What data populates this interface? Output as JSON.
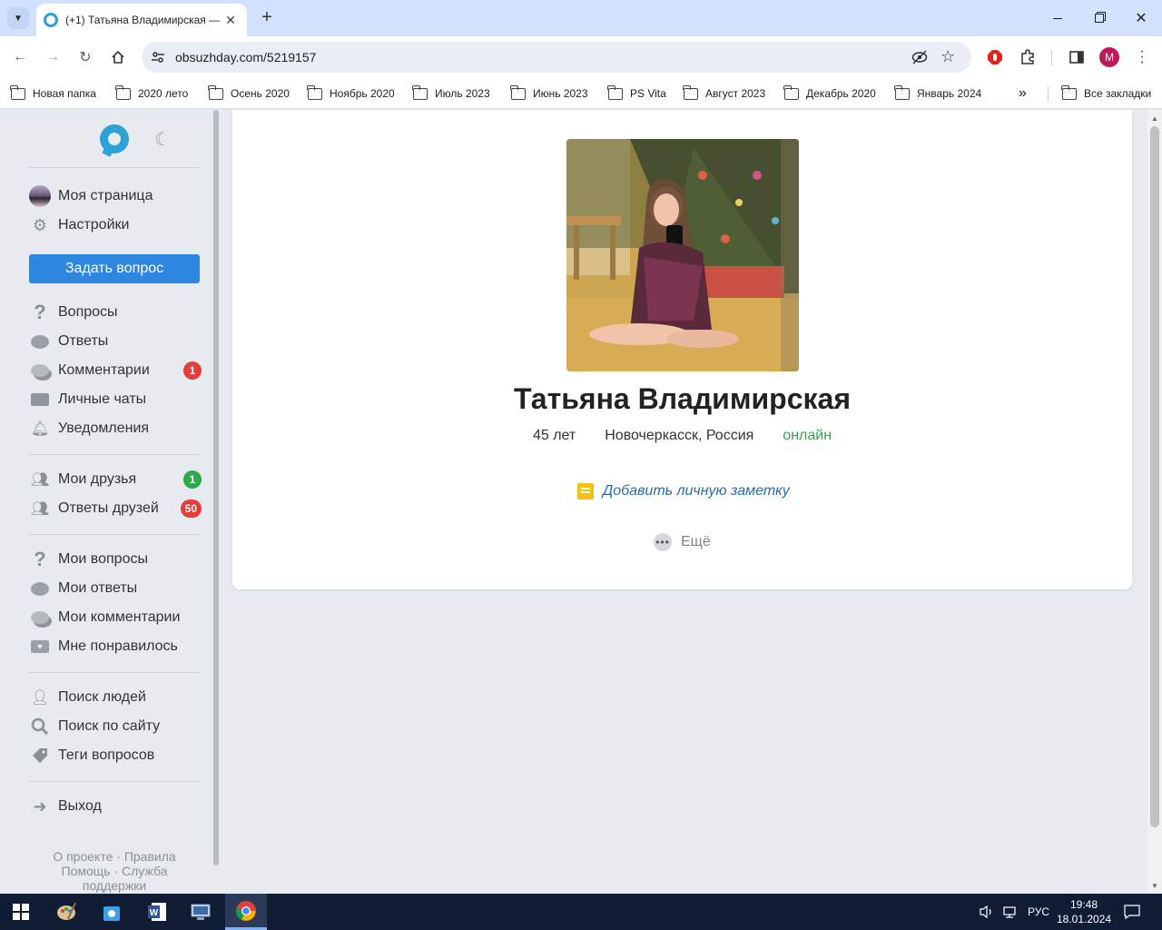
{
  "browser": {
    "tab_title": "(+1) Татьяна Владимирская —",
    "url": "obsuzhday.com/5219157",
    "profile_initial": "M",
    "bookmarks": [
      "Новая папка",
      "2020 лето",
      "Осень 2020",
      "Ноябрь 2020",
      "Июль 2023",
      "Июнь 2023",
      "PS Vita",
      "Август 2023",
      "Декабрь 2020",
      "Январь 2024"
    ],
    "all_bookmarks": "Все закладки"
  },
  "sidebar": {
    "my_page": "Моя страница",
    "settings": "Настройки",
    "ask_button": "Задать вопрос",
    "questions": "Вопросы",
    "answers": "Ответы",
    "comments": "Комментарии",
    "comments_badge": "1",
    "chats": "Личные чаты",
    "notifications": "Уведомления",
    "friends": "Мои друзья",
    "friends_badge": "1",
    "friends_answers": "Ответы друзей",
    "friends_answers_badge": "50",
    "my_questions": "Мои вопросы",
    "my_answers": "Мои ответы",
    "my_comments": "Мои комментарии",
    "liked": "Мне понравилось",
    "people_search": "Поиск людей",
    "site_search": "Поиск по сайту",
    "tags": "Теги вопросов",
    "logout": "Выход",
    "footer": {
      "about": "О проекте",
      "rules": "Правила",
      "help": "Помощь",
      "support": "Служба поддержки",
      "sep": "·"
    }
  },
  "profile": {
    "name": "Татьяна Владимирская",
    "age": "45 лет",
    "location": "Новочеркасск, Россия",
    "status": "онлайн",
    "add_note": "Добавить личную заметку",
    "more": "Ещё"
  },
  "taskbar": {
    "lang": "РУС",
    "time": "19:48",
    "date": "18.01.2024"
  },
  "colors": {
    "accent": "#2d86e0",
    "logo": "#2ea1d7",
    "online": "#2ea84a",
    "badge_red": "#e53c3c",
    "note_link": "#2b6aa8"
  }
}
